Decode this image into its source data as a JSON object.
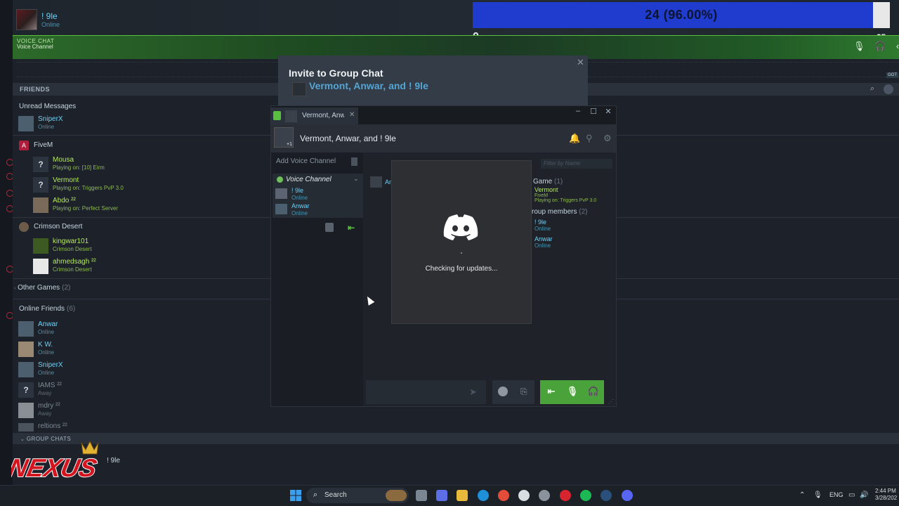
{
  "user": {
    "name": "! 9le",
    "status": "Online"
  },
  "progress": {
    "text": "24  (96.00%)",
    "value": 24,
    "percent": 96.0,
    "min": "0",
    "max": "25",
    "fill_color": "#1f3ccf"
  },
  "voice_bar": {
    "label": "VOICE CHAT",
    "channel": "Voice Channel",
    "accent": "#59bf40"
  },
  "friends": {
    "title": "FRIENDS",
    "got_badge": "GOT",
    "unread": {
      "title": "Unread Messages",
      "items": [
        {
          "name": "SniperX",
          "status": "Online"
        }
      ]
    },
    "fivem": {
      "title": "FiveM",
      "items": [
        {
          "name": "Mousa",
          "status": "Playing on: [10] Eirm"
        },
        {
          "name": "Vermont",
          "status": "Playing on: Triggers PvP 3.0"
        },
        {
          "name": "Abdo ²²",
          "status": "Playing on: Perfect Server"
        }
      ]
    },
    "crimson": {
      "title": "Crimson Desert",
      "items": [
        {
          "name": "kingwar101",
          "status": "Crimson Desert"
        },
        {
          "name": "ahmedsagh ²²",
          "status": "Crimson Desert"
        }
      ]
    },
    "other_games": {
      "title": "Other Games",
      "count": "(2)"
    },
    "online": {
      "title": "Online Friends",
      "count": "(6)",
      "items": [
        {
          "name": "Anwar",
          "status": "Online"
        },
        {
          "name": "K W.",
          "status": "Online"
        },
        {
          "name": "SniperX",
          "status": "Online"
        },
        {
          "name": "IAMS ²²",
          "status": "Away"
        },
        {
          "name": "mdry ²²",
          "status": "Away"
        },
        {
          "name": "reltions ²²",
          "status": ""
        }
      ]
    }
  },
  "group_chats": {
    "title": "GROUP CHATS",
    "item": "! 9le"
  },
  "nexus_logo_text": "NEXUS",
  "invite": {
    "title": "Invite to Group Chat",
    "names": "Vermont, Anwar, and ! 9le",
    "close": "✕"
  },
  "chat": {
    "tab_label": "Vermont, Anw",
    "tab_close": "✕",
    "title": "Vermont, Anwar, and ! 9le",
    "avatar_badge": "+1",
    "add_voice": "Add Voice Channel",
    "voice_channel": {
      "name": "Voice Channel",
      "members": [
        {
          "name": "! 9le",
          "status": "Online"
        },
        {
          "name": "Anwar",
          "status": "Online"
        }
      ]
    },
    "members": {
      "filter_placeholder": "Filter by Name",
      "game_section": "Game",
      "game_count": "(1)",
      "game_member": {
        "name": "Vermont",
        "game": "FiveM",
        "status": "Playing on: Triggers PvP 3.0"
      },
      "group_section": "roup members",
      "group_count": "(2)",
      "group_members": [
        {
          "name": "! 9le",
          "status": "Online"
        },
        {
          "name": "Anwar",
          "status": "Online"
        }
      ]
    },
    "message_author": "An"
  },
  "updater": {
    "text": "Checking for updates..."
  },
  "taskbar": {
    "search_label": "Search",
    "lang": "ENG",
    "time": "2:44 PM",
    "date": "3/28/202"
  }
}
